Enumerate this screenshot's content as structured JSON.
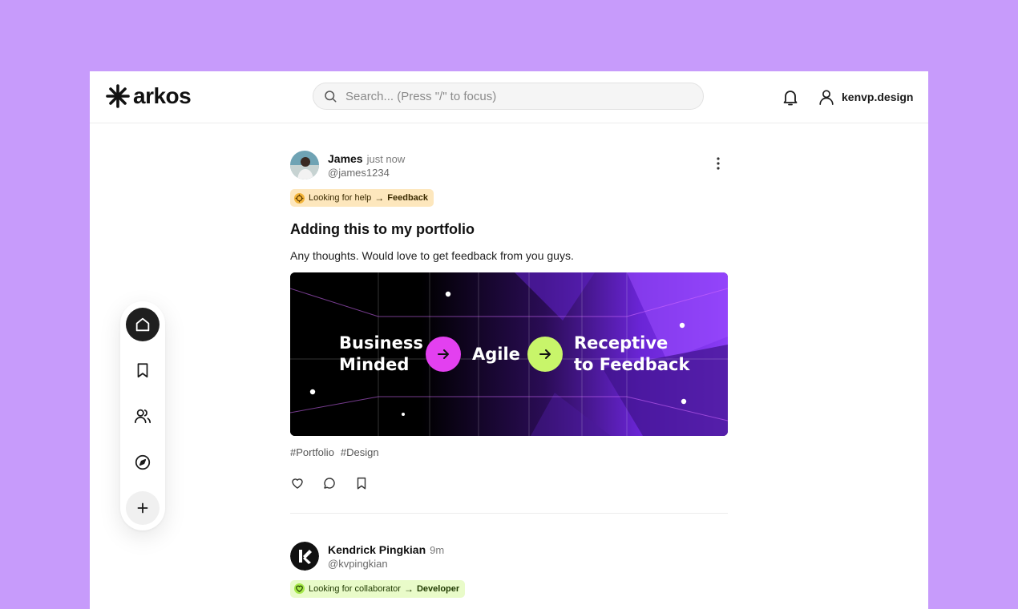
{
  "app": {
    "name": "arkos"
  },
  "search": {
    "placeholder": "Search... (Press \"/\" to focus)"
  },
  "user": {
    "name": "kenvp.design"
  },
  "posts": [
    {
      "author": "James",
      "time": "just now",
      "handle": "@james1234",
      "tag": {
        "label": "Looking for help",
        "target": "Feedback",
        "color": "#fde7bd"
      },
      "title": "Adding this to my portfolio",
      "body": "Any thoughts. Would love to get feedback from you guys.",
      "banner": {
        "step1": [
          "Business",
          "Minded"
        ],
        "step2": "Agile",
        "step3": [
          "Receptive",
          "to Feedback"
        ],
        "accent1": "#e340f0",
        "accent2": "#c8f56a"
      },
      "hashtags": [
        "#Portfolio",
        "#Design"
      ]
    },
    {
      "author": "Kendrick Pingkian",
      "time": "9m",
      "handle": "@kvpingkian",
      "tag": {
        "label": "Looking for collaborator",
        "target": "Developer",
        "color": "#e9fbc9"
      }
    }
  ],
  "colors": {
    "background": "#c79bfb",
    "nav_active": "#1f1f1f",
    "banner_purple": "#7b2ff0"
  }
}
